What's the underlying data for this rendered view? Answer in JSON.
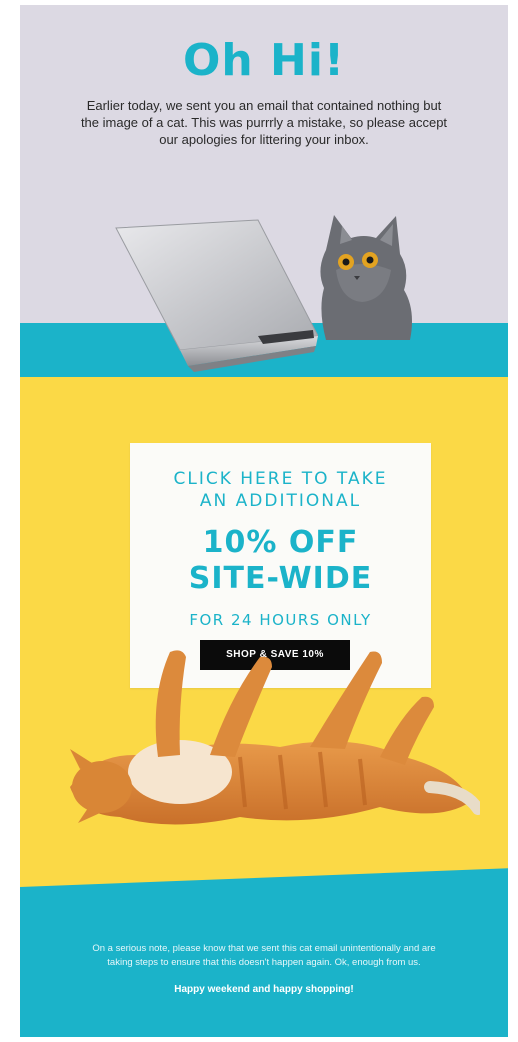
{
  "hero": {
    "title": "Oh Hi!",
    "message": "Earlier today, we sent you an email that contained nothing but the image of a cat. This was purrrly a mistake, so please accept our apologies for littering your inbox."
  },
  "promo": {
    "line1": "CLICK HERE TO TAKE",
    "line2": "AN ADDITIONAL",
    "headline1": "10% OFF",
    "headline2": "SITE-WIDE",
    "subline": "FOR 24 HOURS ONLY",
    "cta_label": "SHOP & SAVE 10%"
  },
  "footer": {
    "message": "On a serious note, please know that we sent this cat email unintentionally and are taking steps to ensure that this doesn't happen again. Ok, enough from us.",
    "signoff": "Happy weekend and happy shopping!"
  },
  "colors": {
    "teal": "#1bb3c9",
    "lavender": "#dcd9e3",
    "yellow": "#fbd946",
    "black": "#0b0b0b"
  },
  "images": {
    "hero": "gray-cat-with-laptop",
    "promo": "orange-tabby-cat-holding-card"
  }
}
